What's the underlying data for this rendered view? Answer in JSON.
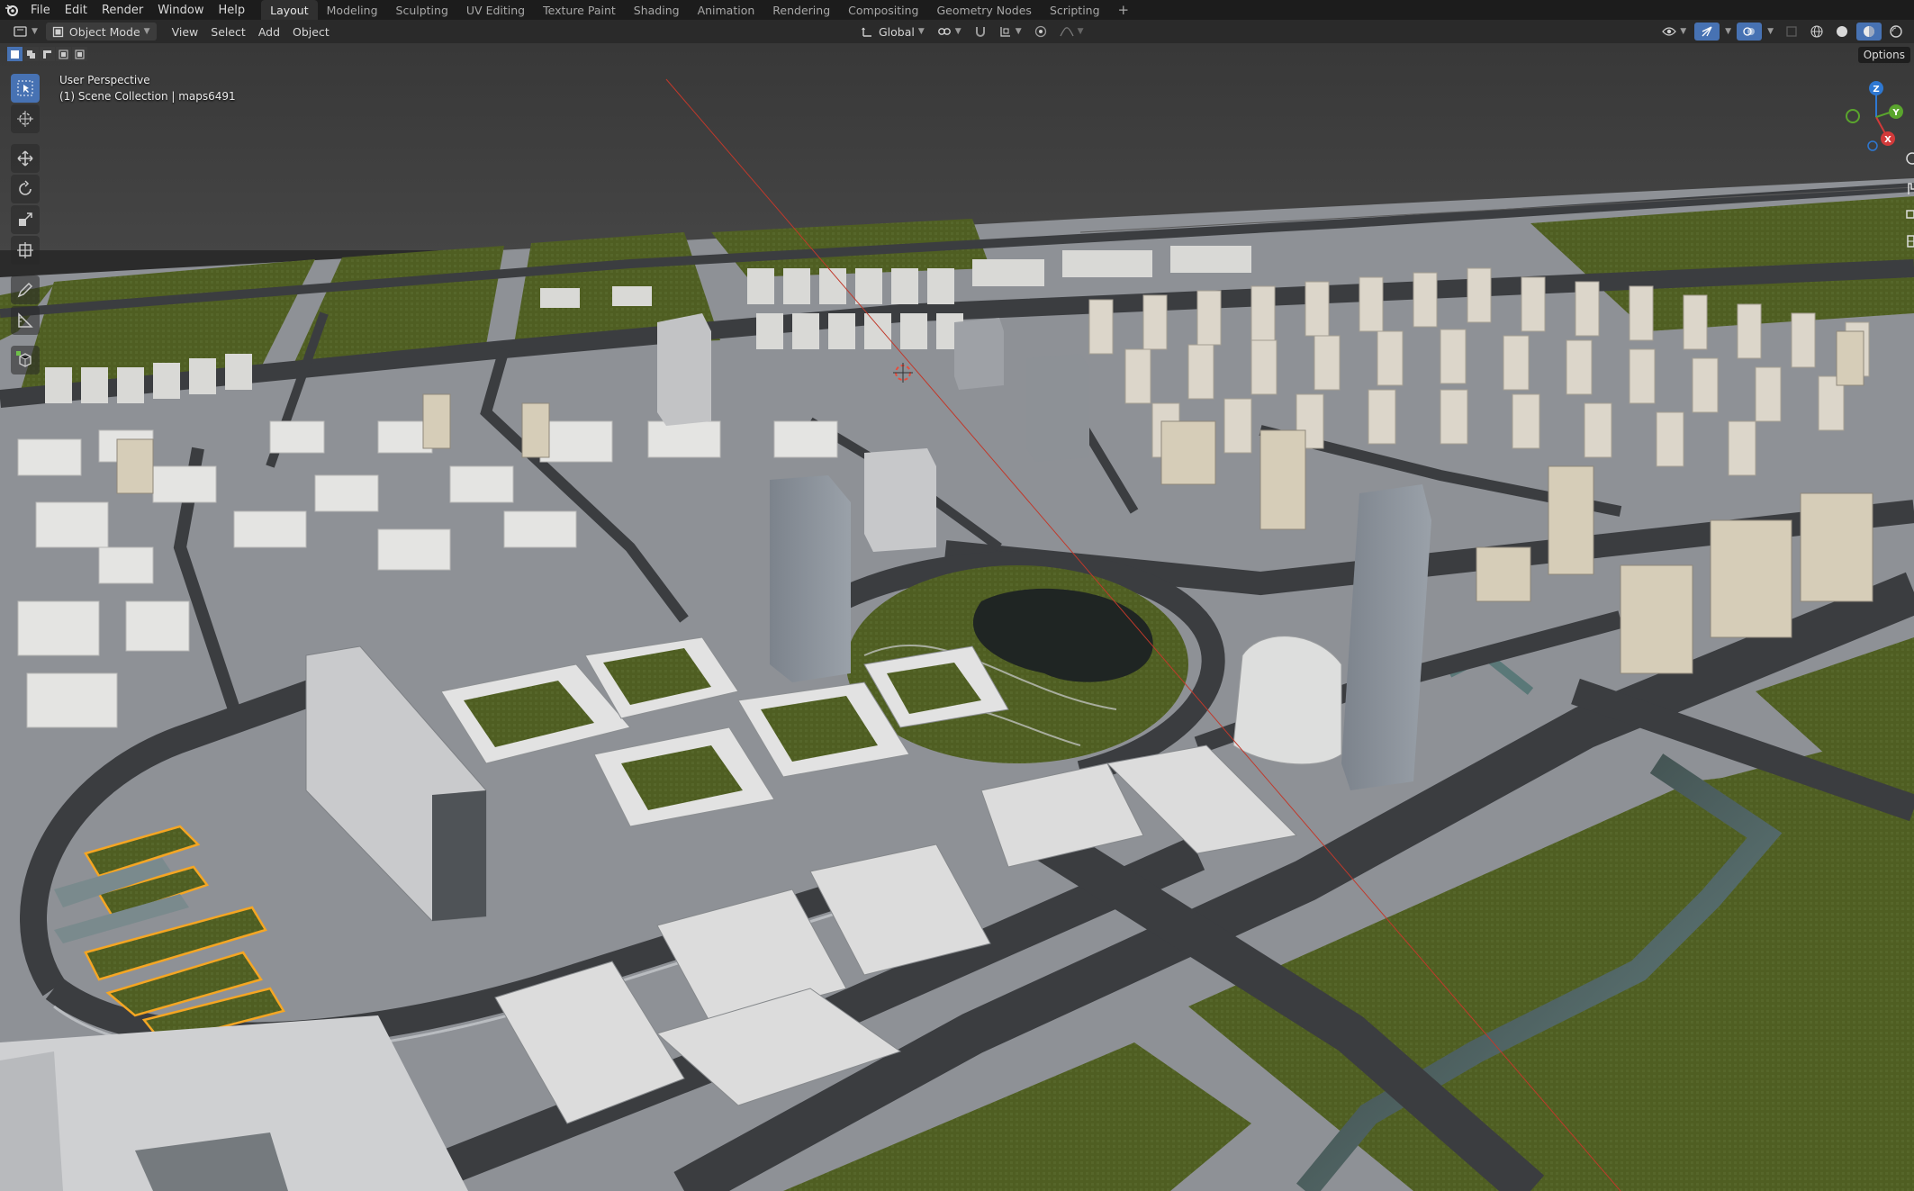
{
  "menu": [
    "File",
    "Edit",
    "Render",
    "Window",
    "Help"
  ],
  "workspaces": [
    "Layout",
    "Modeling",
    "Sculpting",
    "UV Editing",
    "Texture Paint",
    "Shading",
    "Animation",
    "Rendering",
    "Compositing",
    "Geometry Nodes",
    "Scripting"
  ],
  "active_workspace": "Layout",
  "add_workspace": "+",
  "header": {
    "mode": "Object Mode",
    "menus": [
      "View",
      "Select",
      "Add",
      "Object"
    ],
    "orientation": "Global"
  },
  "viewport": {
    "perspective": "User Perspective",
    "collection": "(1) Scene Collection | maps6491",
    "options_label": "Options"
  },
  "gizmo": {
    "z": "Z",
    "x": "X",
    "y": "Y"
  },
  "tools": [
    "select-box",
    "cursor",
    "move",
    "rotate",
    "scale",
    "transform",
    "annotate",
    "measure",
    "add-cube"
  ],
  "colors": {
    "accent": "#4772b3",
    "grass": "#4f5e22",
    "road": "#3b3d40",
    "sky": "#3a3a3a",
    "selection": "#f5a623"
  }
}
